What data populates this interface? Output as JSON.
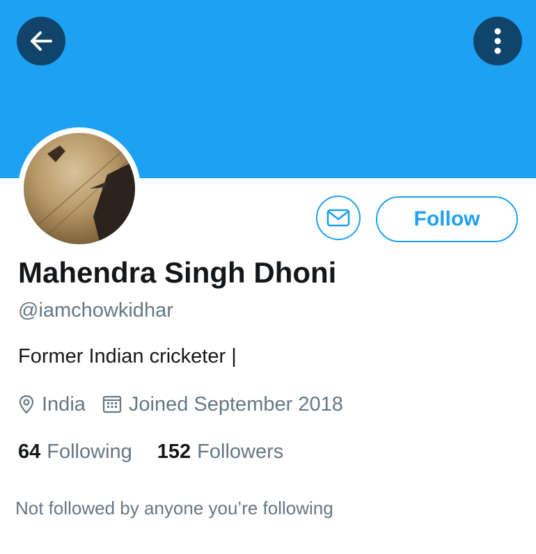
{
  "header": {
    "back_icon": "arrow-left-icon",
    "more_icon": "more-vertical-icon",
    "banner_color": "#1da1f2",
    "button_bg": "#10446b"
  },
  "profile": {
    "name": "Mahendra Singh Dhoni",
    "handle": "@iamchowkidhar",
    "bio": "Former Indian cricketer |",
    "location": "India",
    "location_icon": "location-pin-icon",
    "joined": "Joined September 2018",
    "joined_icon": "calendar-icon"
  },
  "actions": {
    "message_icon": "envelope-icon",
    "follow_label": "Follow",
    "accent": "#1da1f2"
  },
  "stats": {
    "following_count": "64",
    "following_label": "Following",
    "followers_count": "152",
    "followers_label": "Followers"
  },
  "followed_by_note": "Not followed by anyone you’re following"
}
